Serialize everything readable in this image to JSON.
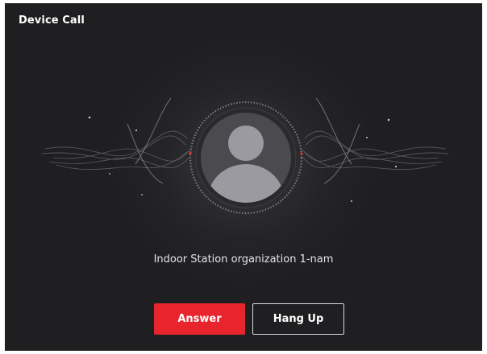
{
  "dialog": {
    "title": "Device Call"
  },
  "caller": {
    "name": "Indoor Station organization 1-nam"
  },
  "actions": {
    "answer_label": "Answer",
    "hangup_label": "Hang Up"
  },
  "colors": {
    "background": "#1f1f21",
    "answer": "#e8242c",
    "avatar_fill": "#9a9aa0",
    "ring_accent": "#e03c3c"
  },
  "icons": {
    "avatar": "person-silhouette-icon"
  }
}
